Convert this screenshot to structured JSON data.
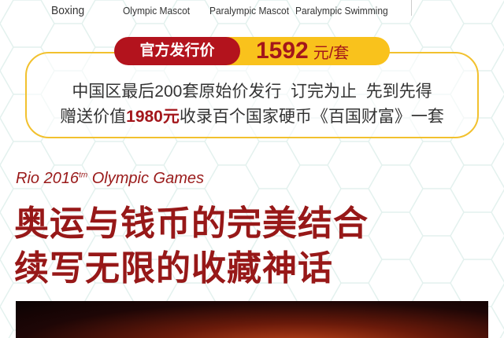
{
  "captions": [
    "Boxing",
    "Olympic Mascot",
    "Paralympic Mascot",
    "Paralympic Swimming"
  ],
  "price_badge": {
    "label": "官方发行价",
    "price": "1592",
    "unit": "元/套"
  },
  "offer": {
    "line1": "中国区最后200套原始价发行  订完为止  先到先得",
    "line2_pre": "赠送价值",
    "line2_highlight": "1980元",
    "line2_post": "收录百个国家硬币《百国财富》一套"
  },
  "subtitle": {
    "text": "Rio 2016",
    "sup": "tm",
    "text2": " Olympic Games"
  },
  "headline": [
    "奥运与钱币的完美结合",
    "续写无限的收藏神话"
  ],
  "colors": {
    "red": "#b3131d",
    "yellow": "#f9c21c",
    "title": "#971818"
  }
}
